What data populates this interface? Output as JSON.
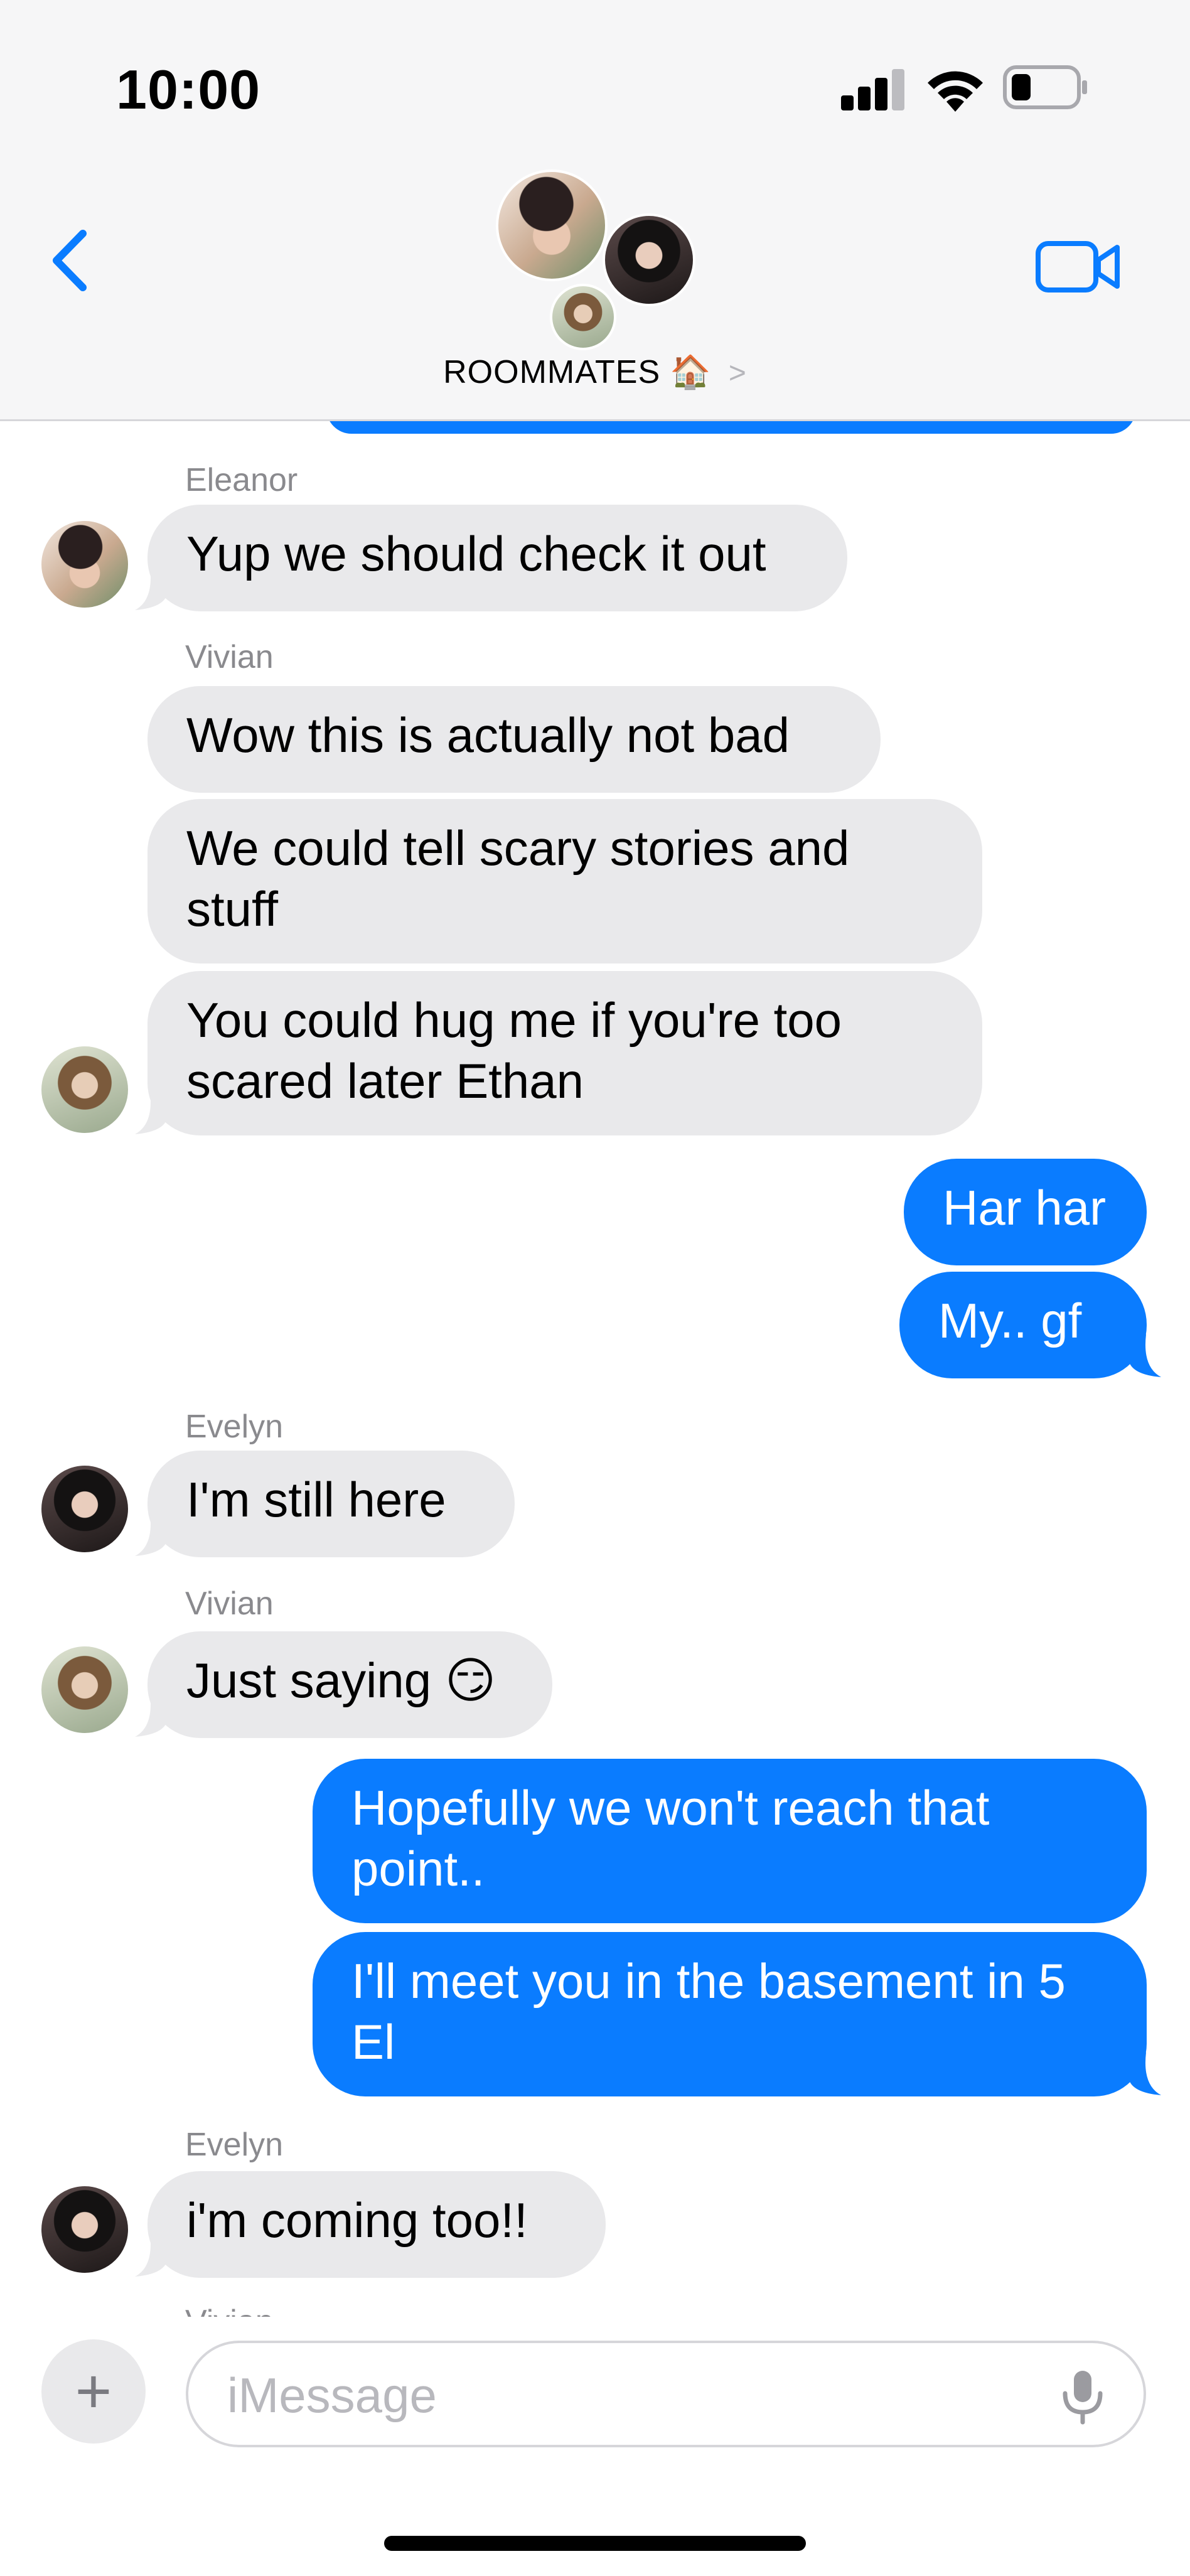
{
  "status_bar": {
    "time": "10:00"
  },
  "header": {
    "group_name": "ROOMMATES",
    "group_emoji": "🏠",
    "chevron": ">"
  },
  "thread": {
    "messages": [
      {
        "sender": "Eleanor",
        "text": "Yup we should check it out",
        "direction": "incoming"
      },
      {
        "sender": "Vivian",
        "text": "Wow this is actually not bad",
        "direction": "incoming"
      },
      {
        "sender": "Vivian",
        "text": "We could tell scary stories and stuff",
        "direction": "incoming"
      },
      {
        "sender": "Vivian",
        "text": "You could hug me if you're too scared later Ethan",
        "direction": "incoming"
      },
      {
        "sender": "",
        "text": "Har har",
        "direction": "outgoing"
      },
      {
        "sender": "",
        "text": "My.. gf",
        "direction": "outgoing"
      },
      {
        "sender": "Evelyn",
        "text": "I'm still here",
        "direction": "incoming"
      },
      {
        "sender": "Vivian",
        "text": "Just saying 😏",
        "direction": "incoming"
      },
      {
        "sender": "",
        "text": "Hopefully we won't reach that point..",
        "direction": "outgoing"
      },
      {
        "sender": "",
        "text": "I'll meet you in the basement in 5 El",
        "direction": "outgoing"
      },
      {
        "sender": "Evelyn",
        "text": "i'm coming too!!",
        "direction": "incoming"
      }
    ],
    "sender_labels": [
      "Eleanor",
      "Vivian",
      "Evelyn",
      "Vivian",
      "Evelyn",
      "Vivian"
    ]
  },
  "composer": {
    "placeholder": "iMessage",
    "plus_label": "+"
  },
  "colors": {
    "outgoing_bubble": "#0a7cff",
    "incoming_bubble": "#e9e9eb",
    "accent": "#0a7cff",
    "sender_label": "#8a8a8e"
  }
}
